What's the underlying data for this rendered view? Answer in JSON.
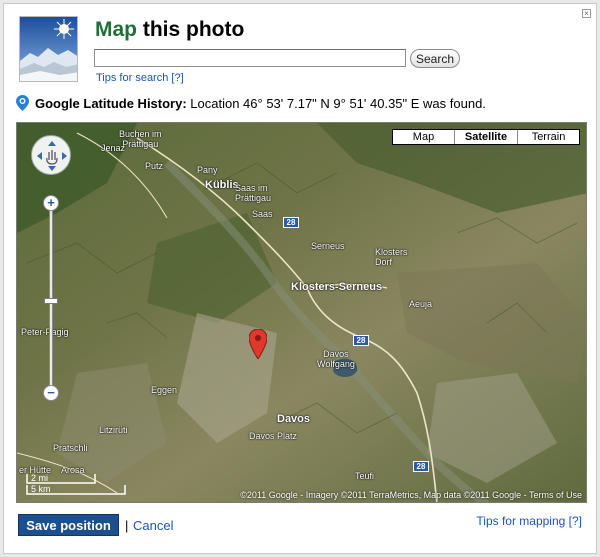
{
  "dialog": {
    "title_accent": "Map",
    "title_rest": " this photo",
    "close_glyph": "×"
  },
  "search": {
    "value": "",
    "placeholder": "",
    "button_label": "Search",
    "tips_label": "Tips for search [?]"
  },
  "latitude": {
    "label": "Google Latitude History:",
    "message": "Location 46° 53' 7.17\" N 9° 51' 40.35\" E was found."
  },
  "map": {
    "types": [
      "Map",
      "Satellite",
      "Terrain"
    ],
    "active_type": "Satellite",
    "places": [
      {
        "name": "Buchen im\nPrättigau"
      },
      {
        "name": "Jenaz"
      },
      {
        "name": "Putz"
      },
      {
        "name": "Pany"
      },
      {
        "name": "Küblis"
      },
      {
        "name": "Saas im\nPrättigau"
      },
      {
        "name": "Saas"
      },
      {
        "name": "Serneus"
      },
      {
        "name": "Klosters\nDorf"
      },
      {
        "name": "Klosters-Serneus"
      },
      {
        "name": "Aeuja"
      },
      {
        "name": "Peter-Pagig"
      },
      {
        "name": "Davos\nWolfgang"
      },
      {
        "name": "Eggen"
      },
      {
        "name": "Davos"
      },
      {
        "name": "Davos Platz"
      },
      {
        "name": "Litzirüti"
      },
      {
        "name": "Pratschli"
      },
      {
        "name": "Teufi"
      },
      {
        "name": "Arosa"
      },
      {
        "name": "er Hütte"
      }
    ],
    "road_number": "28",
    "scale_top": "2 mi",
    "scale_bottom": "5 km",
    "copyright": "©2011 Google - Imagery ©2011 TerraMetrics, Map data ©2011 Google - Terms of Use",
    "zoom_in": "+",
    "zoom_out": "−",
    "zoom_level": 0.52
  },
  "footer": {
    "save_label": "Save position",
    "separator": "|",
    "cancel_label": "Cancel",
    "tips_mapping_label": "Tips for mapping [?]"
  },
  "colors": {
    "title_accent": "#1f6f36",
    "link": "#1a55b3",
    "save_button": "#1b4f8f",
    "road_badge": "#2b5aa8",
    "marker": "#e0392b"
  }
}
